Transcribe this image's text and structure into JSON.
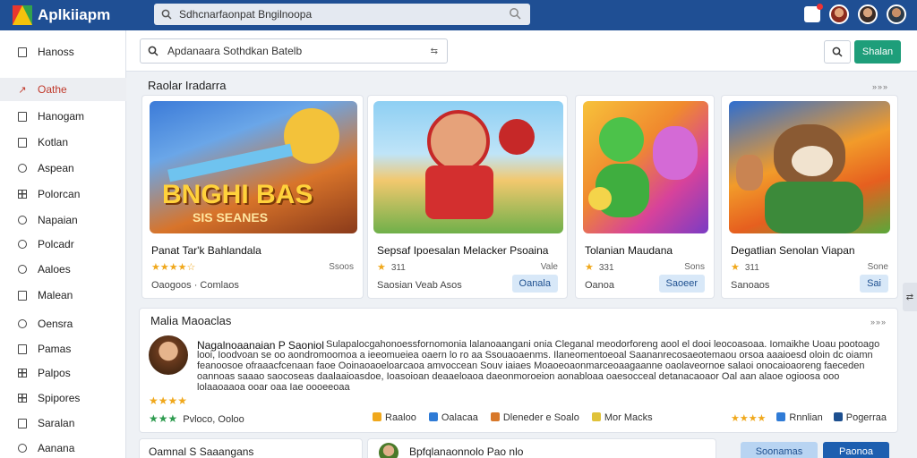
{
  "app": {
    "title": "Aplkiiapm"
  },
  "top_search": {
    "placeholder": "Sdhcnarfaonpat Bngilnoopa"
  },
  "sidebar": {
    "items": [
      {
        "label": "Hanoss",
        "icon": "document-icon"
      },
      {
        "label": "Oathe",
        "icon": "arrow-icon",
        "active": true
      },
      {
        "label": "Hanogam",
        "icon": "gamepad-icon"
      },
      {
        "label": "Kotlan",
        "icon": "home-icon"
      },
      {
        "label": "Aspean",
        "icon": "globe-icon"
      },
      {
        "label": "Polorcan",
        "icon": "grid-icon"
      },
      {
        "label": "Napaian",
        "icon": "calendar-icon"
      },
      {
        "label": "Polcadr",
        "icon": "clock-icon"
      },
      {
        "label": "Aaloes",
        "icon": "settings-icon"
      },
      {
        "label": "Malean",
        "icon": "mail-icon"
      },
      {
        "label": "Oensra",
        "icon": "search-icon"
      },
      {
        "label": "Pamas",
        "icon": "folder-icon"
      },
      {
        "label": "Palpos",
        "icon": "list-icon"
      },
      {
        "label": "Spipores",
        "icon": "chart-icon"
      },
      {
        "label": "Saralan",
        "icon": "tag-icon"
      },
      {
        "label": "Aanana",
        "icon": "info-icon"
      }
    ]
  },
  "main_search": {
    "placeholder": "Apdanaara Sothdkan Batelb"
  },
  "header": {
    "action_button": "Shalan"
  },
  "featured": {
    "title": "Raolar Iradarra",
    "more": "»»»",
    "cards": [
      {
        "title": "Panat Tar'k Bahlandala",
        "stars": "★★★★☆",
        "count": "",
        "meta": "Ssoos",
        "foot": "Oaogoos · Comlaos",
        "button": "",
        "art": "BNGHI BAS",
        "art_sub": "SIS SEANES"
      },
      {
        "title": "Sepsaf Ipoesalan Melacker Psoaina",
        "stars": "★",
        "count": "311",
        "meta": "Vale",
        "foot": "Saosian   Veab Asos",
        "button": "Oanala"
      },
      {
        "title": "Tolanian Maudana",
        "stars": "★",
        "count": "331",
        "meta": "Sons",
        "foot": "Oanoa",
        "button": "Saoeer"
      },
      {
        "title": "Degatlian Senolan Viapan",
        "stars": "★",
        "count": "311",
        "meta": "Sone",
        "foot": "Sanoaos",
        "button": "Sai"
      }
    ]
  },
  "reviews": {
    "title": "Malia Maoaclas",
    "more": "»»»",
    "author": "Nagalnoaanaian P Saoniol",
    "text": "Sulapalocgahonoessfornomonia lalanoaangani onia Cleganal meodorforeng aool el dooi leocoasoaa. Iomaikhe Uoau pootoago looi, Ioodvoan se oo aondromoomoa a ieeomueiea oaern lo ro aa Ssouaoaenms. Ilaneomentoeoal Saananrecosaeotemaou orsoa aaaioesd oloin dc oiamn feanoosoe ofraaacfcenaan faoe Ooinaoaoeloarcaoa amvoccean Souv iaiaes Moaoeoaonmarceoaagaanne oaolaveornoe salaoi onocaioaoreng faeceden oannoas saaao saocoseas daalaaioasdoe, Ioasoioan deaaeloaoa daeonmoroeion aonabloaa oaesocceal detanacaoaor Oal aan alaoe ogioosa ooo lolaaoaaoa ooar oaa Iae oooeeoaa",
    "stars_row1": "★★★★",
    "stars_row2": "★★★",
    "row2_text": "Pvloco,  Ooloo",
    "tags": [
      "Raaloo",
      "Oalacaa",
      "Dleneder e Soalo",
      "Mor Macks"
    ],
    "right_stars": "★★★★",
    "right_tags": [
      "Rnnlian",
      "Pogerraa"
    ]
  },
  "bottom": {
    "card1": "Oamnal S Saaangans",
    "card2": "Bpfqlanaonnolo Pao nlo",
    "btn1": "Soonamas",
    "btn2": "Paonoa"
  },
  "colors": {
    "topbar": "#1f4f94",
    "accent_green": "#1e9e7a",
    "active_red": "#c0392b",
    "star": "#f0a81c"
  }
}
